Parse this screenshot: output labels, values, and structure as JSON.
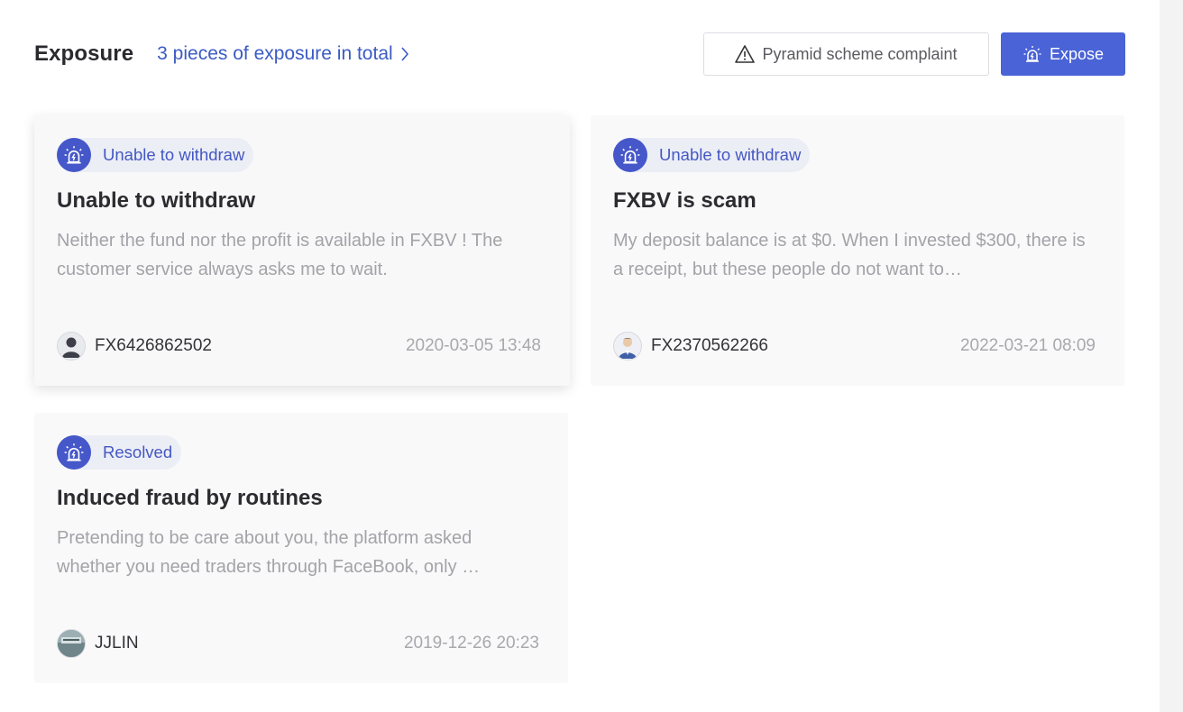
{
  "header": {
    "title": "Exposure",
    "total_link": "3 pieces of exposure in total",
    "complaint_button": "Pyramid scheme complaint",
    "expose_button": "Expose"
  },
  "colors": {
    "accent": "#4a63d6",
    "tag_bg": "#eceef6",
    "link": "#3b5bc4"
  },
  "cards": [
    {
      "tag": "Unable to withdraw",
      "title": "Unable to withdraw",
      "description": "Neither the fund nor the profit is available in FXBV ! The customer service always asks me to wait.",
      "user": "FX6426862502",
      "time": "2020-03-05 13:48",
      "avatar_icon": "person-silhouette-icon"
    },
    {
      "tag": "Unable to withdraw",
      "title": "FXBV is scam",
      "description": "My deposit balance is at $0. When I invested $300, there is a receipt, but these people do not want to…",
      "user": "FX2370562266",
      "time": "2022-03-21 08:09",
      "avatar_icon": "person-suit-icon"
    },
    {
      "tag": "Resolved",
      "title": "Induced fraud by routines",
      "description": "Pretending to be care about you, the platform asked whether you need traders through FaceBook, only …",
      "user": "JJLIN",
      "time": "2019-12-26 20:23",
      "avatar_icon": "photo-avatar-icon"
    }
  ]
}
